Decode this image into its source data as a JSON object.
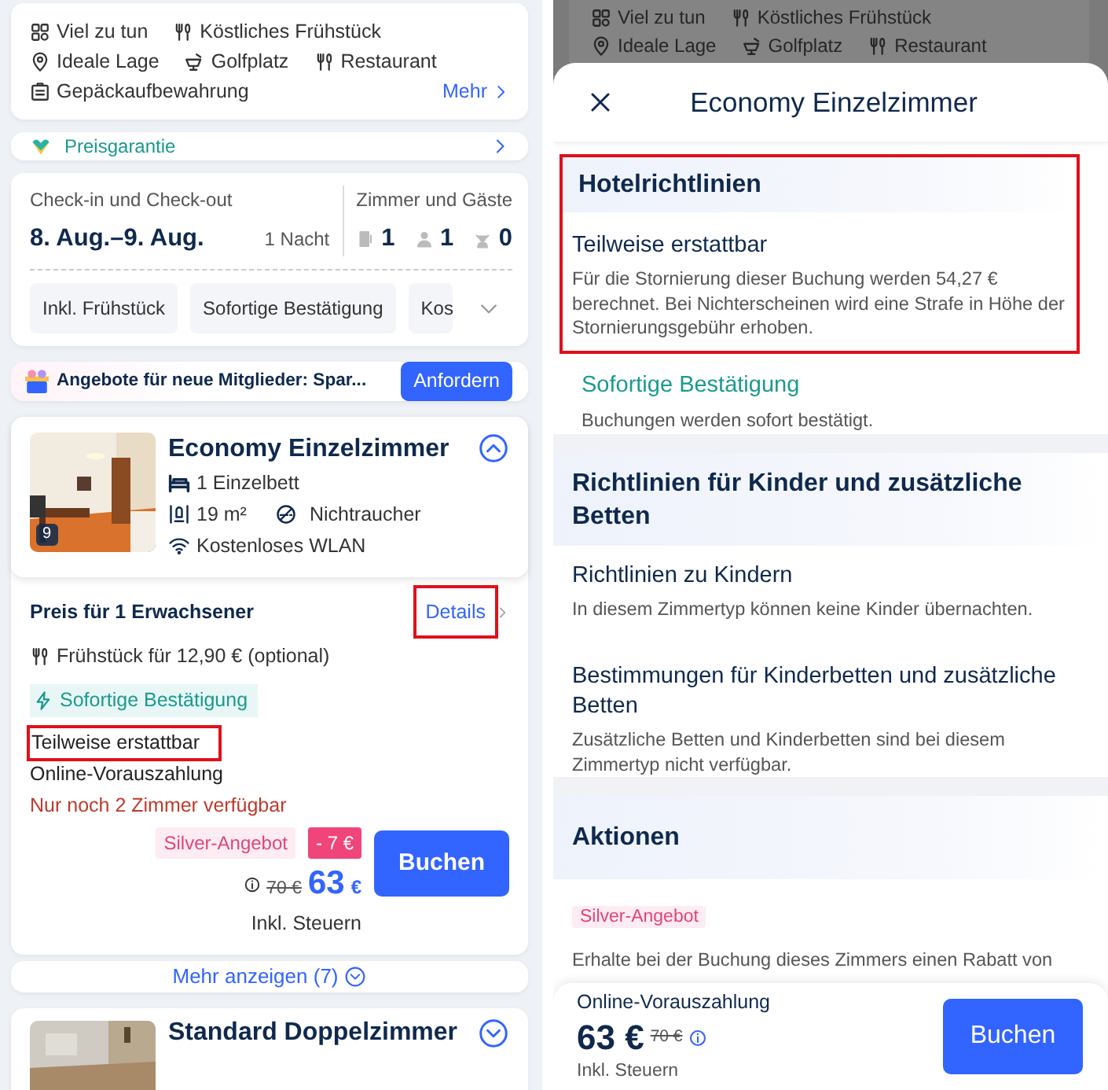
{
  "left": {
    "amenity_rows": [
      [
        {
          "label": "Viel zu tun"
        },
        {
          "label": "Köstliches Frühstück"
        }
      ],
      [
        {
          "label": "Ideale Lage"
        },
        {
          "label": "Golfplatz"
        },
        {
          "label": "Restaurant"
        }
      ],
      [
        {
          "label": "Gepäckaufbewahrung"
        }
      ]
    ],
    "amenities_more": "Mehr",
    "price_guarantee": "Preisgarantie",
    "dates": {
      "label": "Check-in und Check-out",
      "value": "8. Aug.–9. Aug.",
      "nights": "1 Nacht"
    },
    "occupancy": {
      "label": "Zimmer und Gäste",
      "rooms": "1",
      "adults": "1",
      "children": "0"
    },
    "filters": [
      {
        "label": "Inkl. Frühstück"
      },
      {
        "label": "Sofortige Bestätigung"
      },
      {
        "label": "Kos"
      }
    ],
    "promo": {
      "text": "Angebote für neue Mitglieder: Spar...",
      "button": "Anfordern"
    },
    "room": {
      "name": "Economy Einzelzimmer",
      "photo_count": "9",
      "bed": "1 Einzelbett",
      "size": "19 m²",
      "smoking": "Nichtraucher",
      "wifi": "Kostenloses WLAN",
      "expanded": true
    },
    "rate": {
      "title": "Preis für 1 Erwachsener",
      "details": {
        "label": "Details",
        "highlighted": true
      },
      "breakfast": "Frühstück für 12,90 € (optional)",
      "confirmation": "Sofortige Bestätigung",
      "refund": {
        "label": "Teilweise erstattbar",
        "highlighted": true
      },
      "payment": "Online-Vorauszahlung",
      "availability": "Nur noch 2 Zimmer verfügbar",
      "deal": "Silver-Angebot",
      "discount": "- 7 €",
      "old_price": "70 €",
      "price": "63",
      "currency": "€",
      "tax": "Inkl. Steuern",
      "button": "Buchen"
    },
    "show_more": "Mehr anzeigen (7)",
    "next_room": {
      "name": "Standard Doppelzimmer",
      "expanded": false
    }
  },
  "right": {
    "backdrop_rows": [
      [
        "Viel zu tun",
        "Köstliches Frühstück"
      ],
      [
        "Ideale Lage",
        "Golfplatz",
        "Restaurant"
      ]
    ],
    "sheet_title": "Economy Einzelzimmer",
    "sections": [
      {
        "heading": "Hotelrichtlinien",
        "highlighted": true,
        "items": [
          {
            "kind": "plain",
            "title": "Teilweise erstattbar",
            "text": "Für die Stornierung dieser Buchung werden 54,27 € berechnet. Bei Nichterscheinen wird eine Strafe in Höhe der Stornierungsgebühr erhoben.",
            "highlighted": true
          },
          {
            "kind": "accent",
            "title": "Sofortige Bestätigung",
            "text": "Buchungen werden sofort bestätigt.",
            "highlighted": false
          }
        ]
      },
      {
        "heading": "Richtlinien für Kinder und zusätzliche Betten",
        "highlighted": false,
        "items": [
          {
            "kind": "plain",
            "title": "Richtlinien zu Kindern",
            "text": "In diesem Zimmertyp können keine Kinder übernachten.",
            "highlighted": false
          },
          {
            "kind": "plain",
            "title": "Bestimmungen für Kinderbetten und zusätzliche Betten",
            "text": "Zusätzliche Betten und Kinderbetten sind bei diesem Zimmertyp nicht verfügbar.",
            "highlighted": false
          }
        ]
      },
      {
        "heading": "Aktionen",
        "highlighted": false,
        "items": [
          {
            "kind": "tag",
            "title": "Silver-Angebot",
            "text": "Erhalte bei der Buchung dieses Zimmers einen Rabatt von",
            "highlighted": false
          }
        ]
      }
    ],
    "footer": {
      "payment": "Online-Vorauszahlung",
      "price": "63 €",
      "old_price": "70 €",
      "tax": "Inkl. Steuern",
      "button": "Buchen"
    }
  }
}
